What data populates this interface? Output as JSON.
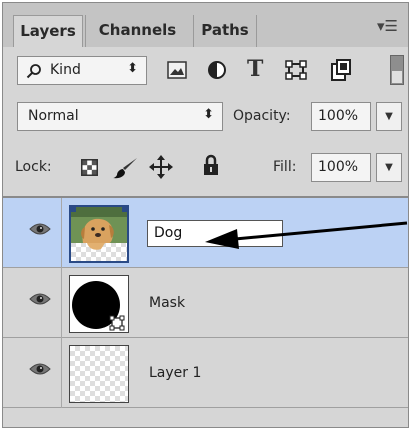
{
  "tabs": [
    {
      "label": "Layers",
      "active": true
    },
    {
      "label": "Channels",
      "active": false
    },
    {
      "label": "Paths",
      "active": false
    }
  ],
  "panel_menu_icon": "panel-menu-icon",
  "filter": {
    "kind_label": "Kind",
    "icons": [
      "image-filter-icon",
      "adjustment-filter-icon",
      "type-filter-icon",
      "shape-filter-icon",
      "smart-object-filter-icon"
    ]
  },
  "blend": {
    "mode": "Normal",
    "opacity_label": "Opacity:",
    "opacity_value": "100%"
  },
  "lock": {
    "label": "Lock:",
    "fill_label": "Fill:",
    "fill_value": "100%",
    "icons": [
      "lock-transparent-icon",
      "lock-paint-icon",
      "lock-position-icon",
      "lock-all-icon"
    ]
  },
  "layers": [
    {
      "name": "Dog",
      "selected": true,
      "editing": true,
      "visible": true,
      "thumbnail": "dog-photo"
    },
    {
      "name": "Mask",
      "selected": false,
      "editing": false,
      "visible": true,
      "thumbnail": "black-circle-shape"
    },
    {
      "name": "Layer 1",
      "selected": false,
      "editing": false,
      "visible": true,
      "thumbnail": "transparent"
    }
  ],
  "colors": {
    "panel_bg": "#d6d6d6",
    "selected_layer_bg": "#bcd2f4",
    "annotation_arrow": "#000000"
  }
}
